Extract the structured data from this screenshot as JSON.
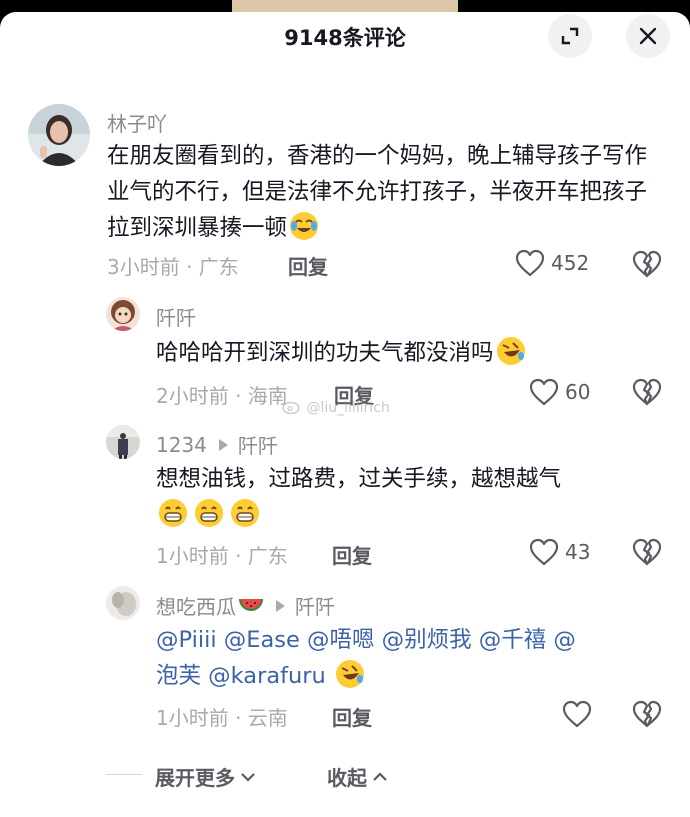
{
  "header": {
    "title": "9148条评论",
    "expand_icon": "expand-icon",
    "close_icon": "close-icon"
  },
  "comments": [
    {
      "author": "林子吖",
      "text": "在朋友圈看到的，香港的一个妈妈，晚上辅导孩子写作业气的不行，但是法律不允许打孩子，半夜开车把孩子拉到深圳暴揍一顿",
      "emoji": "cry-laugh-emoji",
      "meta": "3小时前 · 广东",
      "reply_label": "回复",
      "likes": "452"
    },
    {
      "author": "阡阡",
      "text": "哈哈哈开到深圳的功夫气都没消吗",
      "emoji": "rofl-emoji",
      "meta": "2小时前 · 海南",
      "reply_label": "回复",
      "likes": "60"
    },
    {
      "author": "1234",
      "reply_to": "阡阡",
      "text": "想想油钱，过路费，过关手续，越想越气",
      "emoji": "grin-emoji",
      "meta": "1小时前 · 广东",
      "reply_label": "回复",
      "likes": "43"
    },
    {
      "author": "想吃西瓜",
      "reply_to": "阡阡",
      "mentions_line1": "@Piiii @Ease @唔嗯 @别烦我 @千禧 @",
      "mentions_line2": "泡芙 @karafuru",
      "emoji": "rofl-emoji",
      "meta": "1小时前 · 云南",
      "reply_label": "回复",
      "likes": ""
    }
  ],
  "watermark": "@liu_iiiiirich",
  "footer": {
    "expand_more": "展开更多",
    "collapse": "收起"
  },
  "colors": {
    "mention": "#3c63a8",
    "text": "#161823",
    "meta": "#a8a9ad"
  }
}
